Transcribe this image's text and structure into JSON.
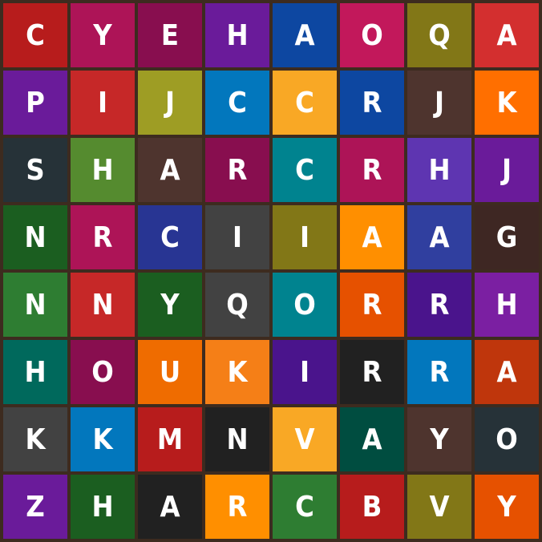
{
  "grid": {
    "rows": [
      [
        {
          "letter": "C",
          "color": "#b71c1c"
        },
        {
          "letter": "Y",
          "color": "#ad1457"
        },
        {
          "letter": "E",
          "color": "#880e4f"
        },
        {
          "letter": "H",
          "color": "#6a1b9a"
        },
        {
          "letter": "A",
          "color": "#0d47a1"
        },
        {
          "letter": "O",
          "color": "#c2185b"
        },
        {
          "letter": "Q",
          "color": "#827717"
        },
        {
          "letter": "A",
          "color": "#d32f2f"
        }
      ],
      [
        {
          "letter": "P",
          "color": "#6a1b9a"
        },
        {
          "letter": "I",
          "color": "#c62828"
        },
        {
          "letter": "J",
          "color": "#9e9d24"
        },
        {
          "letter": "C",
          "color": "#0277bd"
        },
        {
          "letter": "C",
          "color": "#f9a825"
        },
        {
          "letter": "R",
          "color": "#0d47a1"
        },
        {
          "letter": "J",
          "color": "#4e342e"
        },
        {
          "letter": "K",
          "color": "#ff6f00"
        }
      ],
      [
        {
          "letter": "S",
          "color": "#263238"
        },
        {
          "letter": "H",
          "color": "#558b2f"
        },
        {
          "letter": "A",
          "color": "#4e342e"
        },
        {
          "letter": "R",
          "color": "#880e4f"
        },
        {
          "letter": "C",
          "color": "#00838f"
        },
        {
          "letter": "R",
          "color": "#ad1457"
        },
        {
          "letter": "H",
          "color": "#5e35b1"
        },
        {
          "letter": "J",
          "color": "#6a1b9a"
        }
      ],
      [
        {
          "letter": "N",
          "color": "#1b5e20"
        },
        {
          "letter": "R",
          "color": "#ad1457"
        },
        {
          "letter": "C",
          "color": "#283593"
        },
        {
          "letter": "I",
          "color": "#424242"
        },
        {
          "letter": "I",
          "color": "#827717"
        },
        {
          "letter": "A",
          "color": "#ff8f00"
        },
        {
          "letter": "A",
          "color": "#303f9f"
        },
        {
          "letter": "G",
          "color": "#3e2723"
        }
      ],
      [
        {
          "letter": "N",
          "color": "#2e7d32"
        },
        {
          "letter": "N",
          "color": "#c62828"
        },
        {
          "letter": "Y",
          "color": "#1b5e20"
        },
        {
          "letter": "Q",
          "color": "#424242"
        },
        {
          "letter": "O",
          "color": "#00838f"
        },
        {
          "letter": "R",
          "color": "#e65100"
        },
        {
          "letter": "R",
          "color": "#4a148c"
        },
        {
          "letter": "H",
          "color": "#7b1fa2"
        }
      ],
      [
        {
          "letter": "H",
          "color": "#00695c"
        },
        {
          "letter": "O",
          "color": "#880e4f"
        },
        {
          "letter": "U",
          "color": "#ef6c00"
        },
        {
          "letter": "K",
          "color": "#f57f17"
        },
        {
          "letter": "I",
          "color": "#4a148c"
        },
        {
          "letter": "R",
          "color": "#212121"
        },
        {
          "letter": "R",
          "color": "#0277bd"
        },
        {
          "letter": "A",
          "color": "#bf360c"
        }
      ],
      [
        {
          "letter": "K",
          "color": "#424242"
        },
        {
          "letter": "K",
          "color": "#0277bd"
        },
        {
          "letter": "M",
          "color": "#b71c1c"
        },
        {
          "letter": "N",
          "color": "#212121"
        },
        {
          "letter": "V",
          "color": "#f9a825"
        },
        {
          "letter": "A",
          "color": "#004d40"
        },
        {
          "letter": "Y",
          "color": "#4e342e"
        },
        {
          "letter": "O",
          "color": "#263238"
        }
      ],
      [
        {
          "letter": "Z",
          "color": "#6a1b9a"
        },
        {
          "letter": "H",
          "color": "#1b5e20"
        },
        {
          "letter": "A",
          "color": "#212121"
        },
        {
          "letter": "R",
          "color": "#ff8f00"
        },
        {
          "letter": "C",
          "color": "#2e7d32"
        },
        {
          "letter": "B",
          "color": "#b71c1c"
        },
        {
          "letter": "V",
          "color": "#827717"
        },
        {
          "letter": "Y",
          "color": "#e65100"
        }
      ]
    ]
  }
}
